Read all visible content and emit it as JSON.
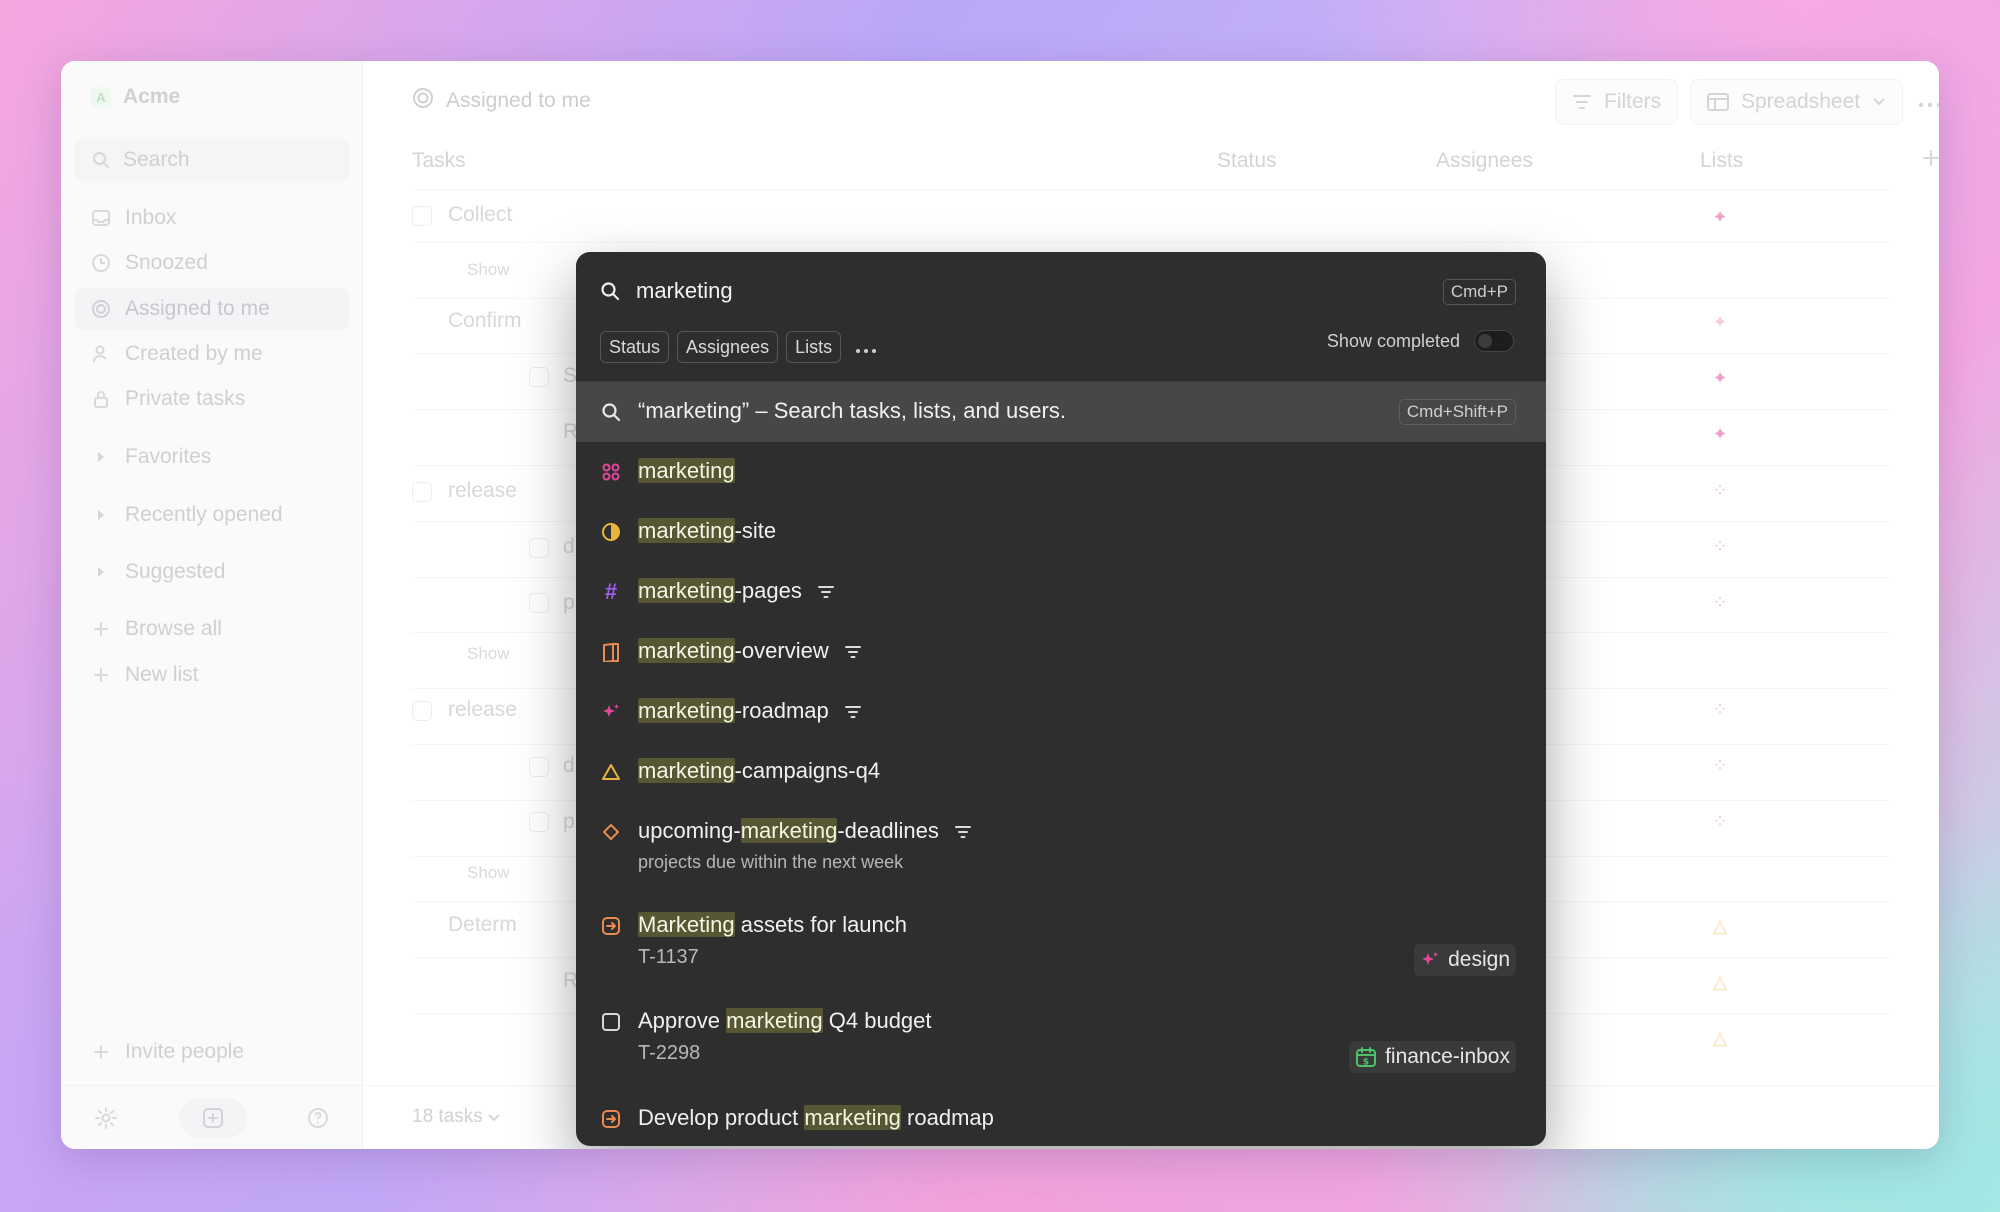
{
  "sidebar": {
    "workspace_initial": "A",
    "workspace_name": "Acme",
    "search_placeholder": "Search",
    "nav": {
      "inbox": "Inbox",
      "snoozed": "Snoozed",
      "assigned": "Assigned to me",
      "created": "Created by me",
      "private": "Private tasks"
    },
    "sections": {
      "favorites": "Favorites",
      "recent": "Recently opened",
      "suggested": "Suggested"
    },
    "actions": {
      "browse_all": "Browse all",
      "new_list": "New list",
      "invite": "Invite people"
    }
  },
  "main": {
    "title": "Assigned to me",
    "filters_label": "Filters",
    "view_label": "Spreadsheet",
    "columns": {
      "tasks": "Tasks",
      "status": "Status",
      "assignees": "Assignees",
      "lists": "Lists"
    },
    "rows": {
      "r1": "Collect",
      "r2": "Show",
      "r3": "Confirm",
      "r4": "S",
      "r5": "R",
      "r6": "release",
      "r7": "d",
      "r8": "p",
      "r9": "Show",
      "r10": "release",
      "r11": "d",
      "r12": "p",
      "r13": "Show",
      "r14": "Determ",
      "r15": "R"
    },
    "task_count": "18 tasks"
  },
  "palette": {
    "query": "marketing",
    "shortcut": "Cmd+P",
    "chips": {
      "status": "Status",
      "assignees": "Assignees",
      "lists": "Lists"
    },
    "show_completed": "Show completed",
    "search_all": {
      "text": "“marketing” – Search tasks, lists, and users.",
      "shortcut": "Cmd+Shift+P"
    },
    "highlight": "marketing",
    "highlight_cap": "Marketing",
    "results": {
      "r1": {
        "suffix": ""
      },
      "r2": {
        "suffix": "-site"
      },
      "r3": {
        "suffix": "-pages"
      },
      "r4": {
        "suffix": "-overview"
      },
      "r5": {
        "suffix": "-roadmap"
      },
      "r6": {
        "suffix": "-campaigns-q4"
      },
      "r7": {
        "prefix": "upcoming-",
        "suffix": "-deadlines",
        "description": "projects due within the next week"
      },
      "r8": {
        "suffix": " assets for launch",
        "id": "T-1137",
        "tag": "design"
      },
      "r9": {
        "prefix": "Approve ",
        "suffix": " Q4 budget",
        "id": "T-2298",
        "tag": "finance-inbox"
      },
      "r10": {
        "prefix": "Develop product ",
        "suffix": " roadmap"
      }
    },
    "colors": {
      "pink": "#e6479b",
      "amber": "#e8b53a",
      "purple": "#9b5cf0",
      "orange": "#e98a4e",
      "green": "#4cc36b"
    }
  }
}
